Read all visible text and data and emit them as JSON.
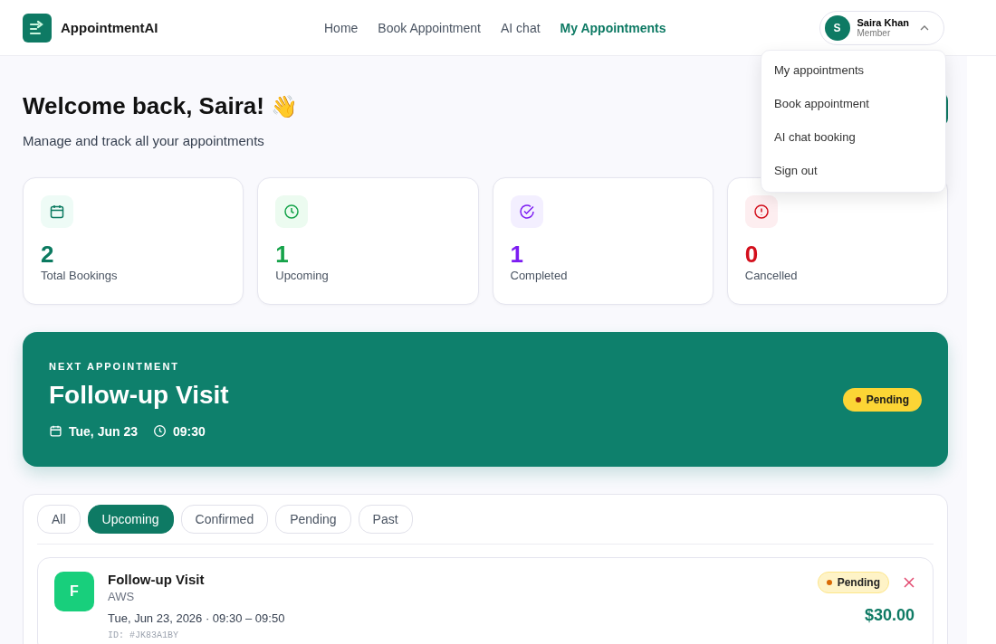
{
  "header": {
    "brand": "AppointmentAI",
    "nav": [
      {
        "label": "Home",
        "selected": false
      },
      {
        "label": "Book Appointment",
        "selected": false
      },
      {
        "label": "AI chat",
        "selected": false
      },
      {
        "label": "My Appointments",
        "selected": true
      }
    ],
    "user": {
      "initial": "S",
      "name": "Saira Khan",
      "role": "Member"
    }
  },
  "user_menu": {
    "expanded": true,
    "items": [
      "My appointments",
      "Book appointment",
      "AI chat booking",
      "Sign out"
    ]
  },
  "welcome": {
    "title": "Welcome back, Saira!",
    "emoji": "👋",
    "subtitle": "Manage and track all your appointments"
  },
  "stats": [
    {
      "kind": "calendar",
      "value": "2",
      "label": "Total Bookings",
      "color": "#0b7a60"
    },
    {
      "kind": "clock",
      "value": "1",
      "label": "Upcoming",
      "color": "#16a34a"
    },
    {
      "kind": "check",
      "value": "1",
      "label": "Completed",
      "color": "#7c1cf2"
    },
    {
      "kind": "alert",
      "value": "0",
      "label": "Cancelled",
      "color": "#d30f1c"
    }
  ],
  "next_appointment": {
    "eyebrow": "NEXT APPOINTMENT",
    "title": "Follow-up Visit",
    "date": "Tue, Jun 23",
    "time": "09:30",
    "status": "Pending"
  },
  "filters": [
    {
      "label": "All",
      "selected": false
    },
    {
      "label": "Upcoming",
      "selected": true
    },
    {
      "label": "Confirmed",
      "selected": false
    },
    {
      "label": "Pending",
      "selected": false
    },
    {
      "label": "Past",
      "selected": false
    }
  ],
  "appointments": [
    {
      "initial": "F",
      "title": "Follow-up Visit",
      "provider": "AWS",
      "when": "Tue, Jun 23, 2026 · 09:30 – 09:50",
      "id": "ID: #JK83A1BY",
      "status": "Pending",
      "price": "$30.00"
    }
  ]
}
